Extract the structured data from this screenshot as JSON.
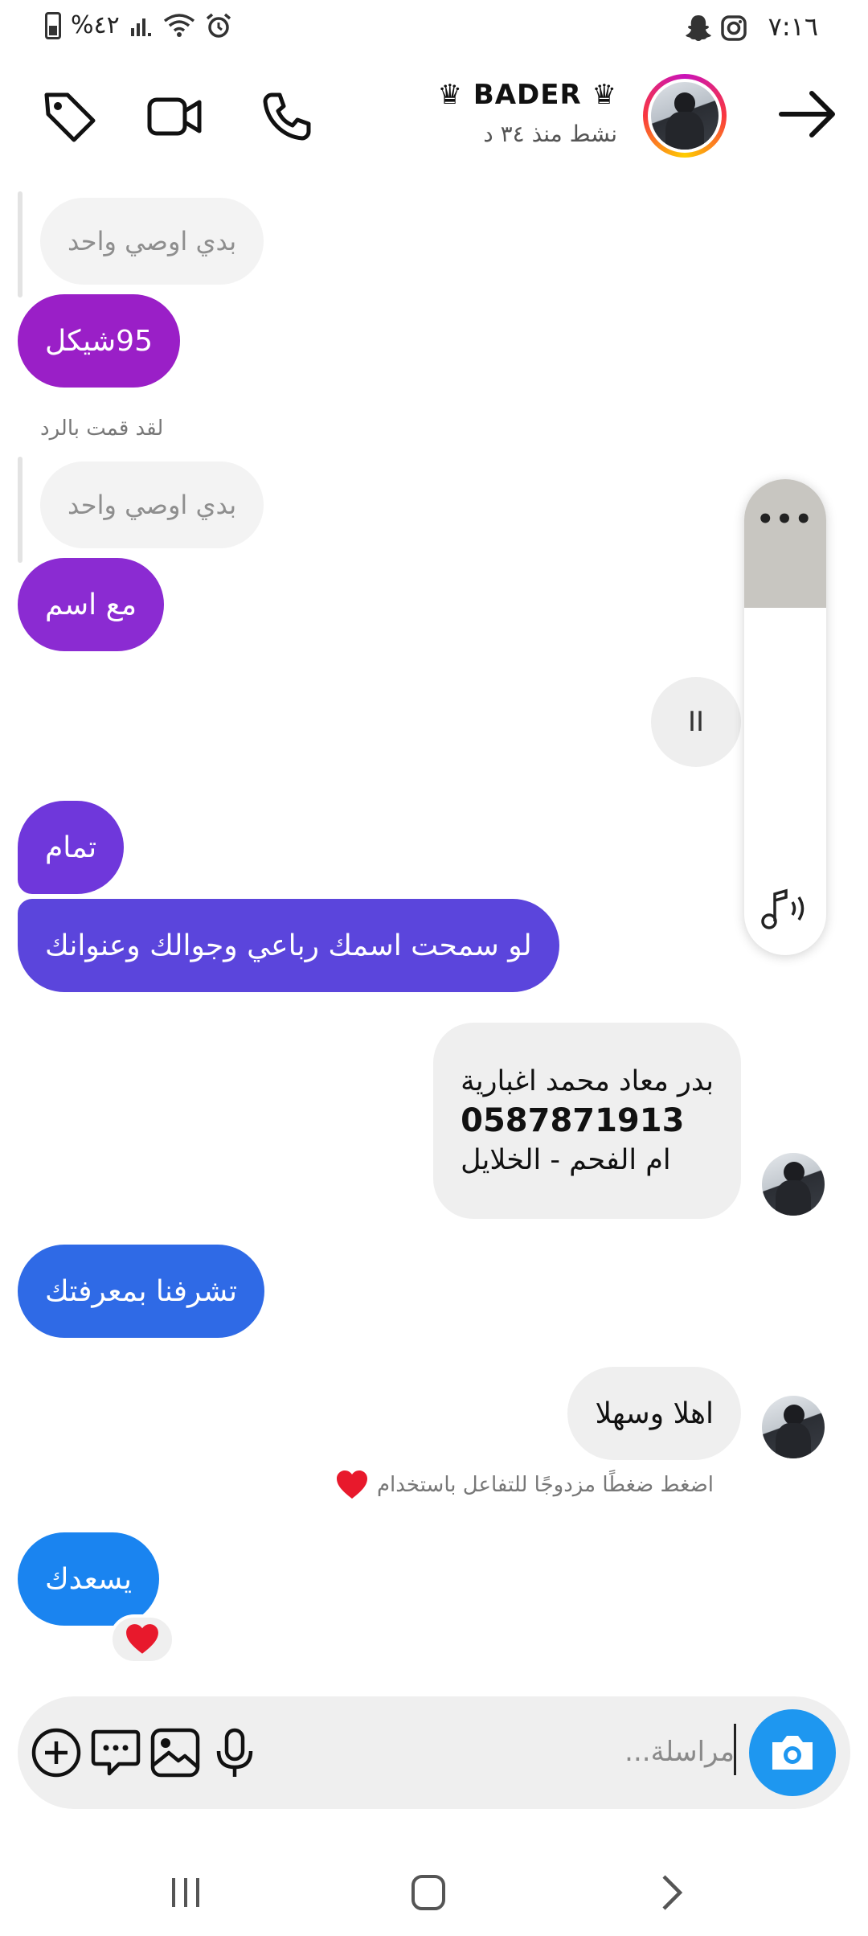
{
  "status_bar": {
    "time": "٧:١٦",
    "battery": "%٤٢",
    "icons": [
      "snapchat-icon",
      "instagram-icon",
      "battery-icon",
      "signal-icon",
      "wifi-icon",
      "alarm-icon"
    ]
  },
  "header": {
    "contact_name": "♛ BADER ♛",
    "active_status": "نشط منذ ٣٤ د",
    "icons": [
      "back-arrow-icon",
      "phone-icon",
      "video-icon",
      "tag-icon"
    ]
  },
  "messages": [
    {
      "type": "quoted",
      "text": "بدي اوصي واحد"
    },
    {
      "type": "outgoing",
      "text": "95شيكل",
      "color": "#9a1fc7"
    },
    {
      "type": "reply_label",
      "text": "لقد قمت بالرد"
    },
    {
      "type": "quoted",
      "text": "بدي اوصي واحد"
    },
    {
      "type": "outgoing",
      "text": "مع اسم",
      "color": "#8b2bd2"
    },
    {
      "type": "outgoing",
      "text": "تمام",
      "color": "#6f37db"
    },
    {
      "type": "outgoing",
      "text": "لو سمحت اسمك رباعي وجوالك وعنوانك",
      "color": "#5b45dc"
    },
    {
      "type": "incoming",
      "lines": [
        "بدر معاد محمد اغبارية",
        "0587871913",
        "ام الفحم - الخلايل"
      ]
    },
    {
      "type": "outgoing",
      "text": "تشرفنا بمعرفتك",
      "color": "#2f6ae6"
    },
    {
      "type": "incoming",
      "text": "اهلا وسهلا"
    },
    {
      "type": "hint",
      "text": "اضغط ضغطًا مزدوجًا للتفاعل باستخدام"
    },
    {
      "type": "outgoing",
      "text": "يسعدك",
      "color": "#1a84f0",
      "reaction": "heart"
    }
  ],
  "media_control": {
    "pause_symbol": "II"
  },
  "volume_panel": {
    "more_label": "•••",
    "level": 0.27
  },
  "composer": {
    "placeholder": "مراسلة...",
    "icons": [
      "camera-icon",
      "microphone-icon",
      "gallery-icon",
      "sticker-icon",
      "add-icon"
    ]
  },
  "colors": {
    "accent_blue": "#1e97f0",
    "heart": "#e8192c"
  }
}
